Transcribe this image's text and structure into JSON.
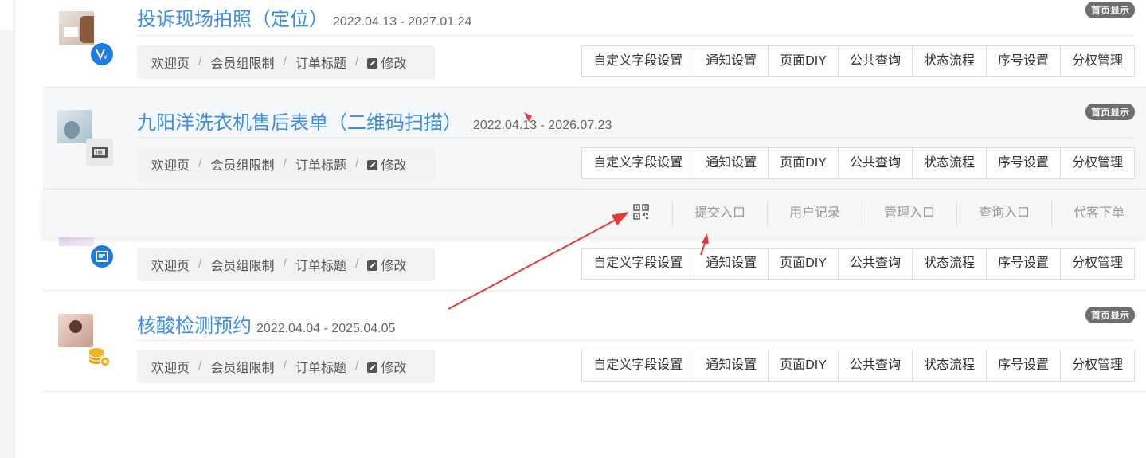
{
  "rows": [
    {
      "title": "投诉现场拍照（定位）",
      "date_range": "2022.04.13 - 2027.01.24",
      "home_tag": "首页显示"
    },
    {
      "title": "九阳洋洗衣机售后表单（二维码扫描）",
      "date_range": "2022.04.13 - 2026.07.23",
      "home_tag": "首页显示"
    },
    {
      "title": "核酸检测预约",
      "date_range": "2022.04.04 - 2025.04.05",
      "home_tag": "首页显示"
    }
  ],
  "breadcrumb": {
    "welcome": "欢迎页",
    "member_limit": "会员组限制",
    "order_title": "订单标题",
    "edit": "修改",
    "separator": "/"
  },
  "actions": {
    "custom_fields": "自定义字段设置",
    "notify": "通知设置",
    "page_diy": "页面DIY",
    "public_query": "公共查询",
    "status_flow": "状态流程",
    "serial": "序号设置",
    "permission": "分权管理"
  },
  "popup": {
    "submit": "提交入口",
    "user_records": "用户记录",
    "manage": "管理入口",
    "query": "查询入口",
    "proxy_order": "代客下单"
  },
  "colors": {
    "title_blue": "#3a8ee6",
    "badge_blue": "#1e7be0",
    "badge_gold": "#f0b429",
    "annotation_red": "#e53935",
    "tag_gray": "#6e6e6e"
  },
  "icons": [
    "wechat-pay-icon",
    "barcode-scan-icon",
    "form-icon",
    "coin-stack-icon",
    "qrcode-icon",
    "edit-icon"
  ]
}
